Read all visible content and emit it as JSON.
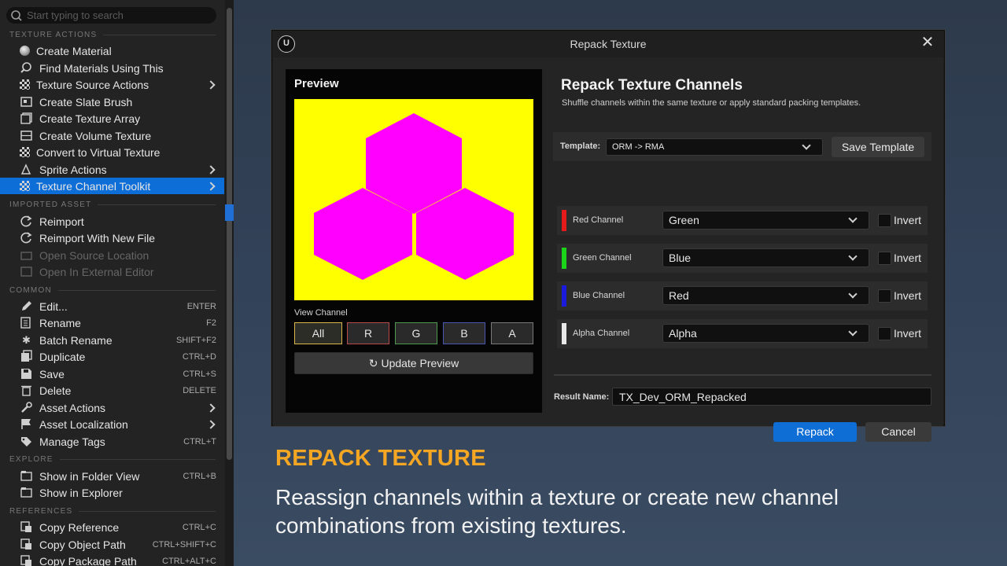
{
  "menu": {
    "search_placeholder": "Start typing to search",
    "sections": {
      "texture_actions": "TEXTURE ACTIONS",
      "imported_asset": "IMPORTED ASSET",
      "common": "COMMON",
      "explore": "EXPLORE",
      "references": "REFERENCES"
    },
    "items": {
      "create_material": "Create Material",
      "find_materials": "Find Materials Using This",
      "texture_source_actions": "Texture Source Actions",
      "create_slate_brush": "Create Slate Brush",
      "create_texture_array": "Create Texture Array",
      "create_volume_texture": "Create Volume Texture",
      "convert_virtual_texture": "Convert to Virtual Texture",
      "sprite_actions": "Sprite Actions",
      "texture_channel_toolkit": "Texture Channel Toolkit",
      "reimport": "Reimport",
      "reimport_new_file": "Reimport With New File",
      "open_source_location": "Open Source Location",
      "open_external_editor": "Open In External Editor",
      "edit": "Edit...",
      "rename": "Rename",
      "batch_rename": "Batch Rename",
      "duplicate": "Duplicate",
      "save": "Save",
      "delete": "Delete",
      "asset_actions": "Asset Actions",
      "asset_localization": "Asset Localization",
      "manage_tags": "Manage Tags",
      "show_folder_view": "Show in Folder View",
      "show_explorer": "Show in Explorer",
      "copy_reference": "Copy Reference",
      "copy_object_path": "Copy Object Path",
      "copy_package_path": "Copy Package Path"
    },
    "shortcuts": {
      "edit": "ENTER",
      "rename": "F2",
      "batch_rename": "SHIFT+F2",
      "duplicate": "CTRL+D",
      "save": "CTRL+S",
      "delete": "DELETE",
      "manage_tags": "CTRL+T",
      "show_folder_view": "CTRL+B",
      "copy_reference": "CTRL+C",
      "copy_object_path": "CTRL+SHIFT+C",
      "copy_package_path": "CTRL+ALT+C"
    },
    "selected_item": "Texture Channel Toolkit"
  },
  "dialog": {
    "logo": "U",
    "title": "Repack Texture",
    "close": "✕",
    "preview": {
      "title": "Preview",
      "view_channel_label": "View Channel",
      "channels": [
        "All",
        "R",
        "G",
        "B",
        "A"
      ],
      "selected_channel": "All",
      "update_button": "Update Preview",
      "update_icon": "↻",
      "image_colors": {
        "background": "#ffff00",
        "hexagons": "#ff00ff"
      }
    },
    "heading": "Repack Texture Channels",
    "subheading": "Shuffle channels within the same texture or apply standard packing templates.",
    "template": {
      "label": "Template:",
      "value": "ORM -> RMA",
      "save_button": "Save Template"
    },
    "channel_rows": [
      {
        "name": "Red Channel",
        "value": "Green",
        "invert_label": "Invert",
        "inverted": false,
        "color": "#e51b1b"
      },
      {
        "name": "Green Channel",
        "value": "Blue",
        "invert_label": "Invert",
        "inverted": false,
        "color": "#1bd51b"
      },
      {
        "name": "Blue Channel",
        "value": "Red",
        "invert_label": "Invert",
        "inverted": false,
        "color": "#1b1bdd"
      },
      {
        "name": "Alpha Channel",
        "value": "Alpha",
        "invert_label": "Invert",
        "inverted": false,
        "color": "#e8e8e8"
      }
    ],
    "result": {
      "label": "Result Name:",
      "value": "TX_Dev_ORM_Repacked"
    },
    "repack_button": "Repack",
    "cancel_button": "Cancel"
  },
  "caption": {
    "title": "REPACK TEXTURE",
    "body": "Reassign channels within a texture or create new channel combinations from existing textures."
  },
  "colors": {
    "accent_blue": "#0f6ed6",
    "caption_orange": "#f5a623",
    "background": "#33435a"
  }
}
